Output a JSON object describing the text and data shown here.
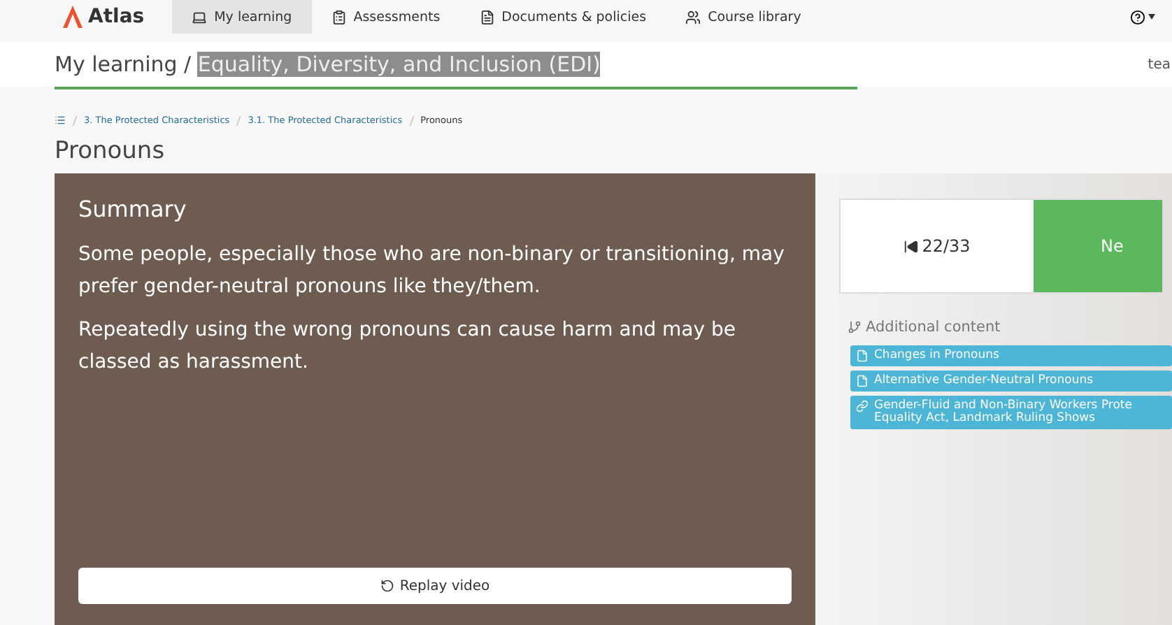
{
  "nav": {
    "logo": "Atlas",
    "tabs": [
      {
        "label": "My learning",
        "selected": true
      },
      {
        "label": "Assessments",
        "selected": false
      },
      {
        "label": "Documents & policies",
        "selected": false
      },
      {
        "label": "Course library",
        "selected": false
      }
    ]
  },
  "header": {
    "prefix": "My learning / ",
    "course": "Equality, Diversity, and Inclusion (EDI)",
    "right": "tea"
  },
  "breadcrumb": [
    "3. The Protected Characteristics",
    "3.1. The Protected Characteristics",
    "Pronouns"
  ],
  "page_title": "Pronouns",
  "video": {
    "heading": "Summary",
    "paragraphs": [
      "Some people, especially those who are non-binary or transitioning, may prefer gender-neutral pronouns like they/them.",
      "Repeatedly using the wrong pronouns can cause harm and may be classed as harassment."
    ],
    "replay": "Replay video"
  },
  "pager": {
    "position": "22/33",
    "next": "Ne"
  },
  "additional": {
    "title": "Additional content",
    "links": [
      {
        "kind": "document",
        "lines": [
          "Changes in Pronouns"
        ]
      },
      {
        "kind": "document",
        "lines": [
          "Alternative Gender-Neutral Pronouns"
        ]
      },
      {
        "kind": "link",
        "lines": [
          "Gender-Fluid and Non-Binary Workers Prote",
          "Equality Act, Landmark Ruling Shows"
        ]
      }
    ]
  }
}
